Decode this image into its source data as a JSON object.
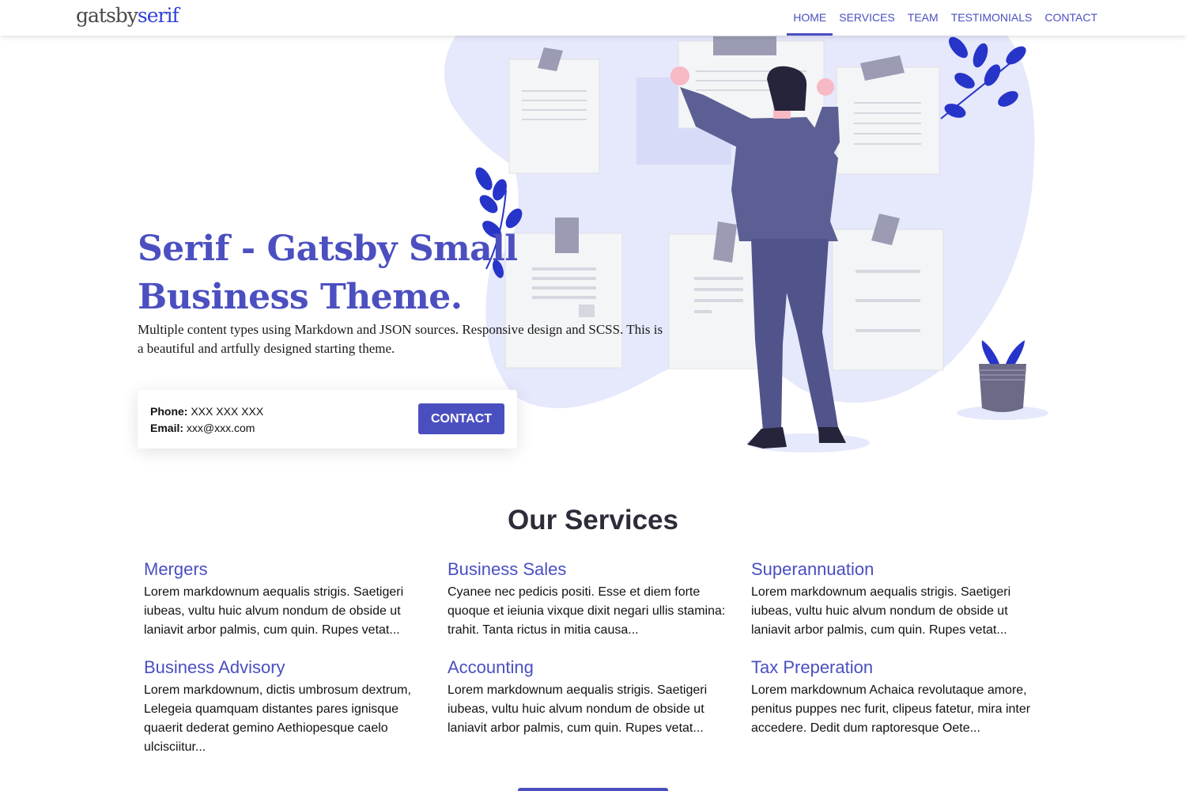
{
  "header": {
    "logo_part1": "gatsby",
    "logo_part2": "serif",
    "nav": [
      "HOME",
      "SERVICES",
      "TEAM",
      "TESTIMONIALS",
      "CONTACT"
    ],
    "active_nav": "HOME"
  },
  "hero": {
    "title": "Serif - Gatsby Small Business Theme.",
    "description": "Multiple content types using Markdown and JSON sources. Responsive design and SCSS. This is a beautiful and artfully designed starting theme."
  },
  "contact_card": {
    "phone_label": "Phone:",
    "phone_value": "XXX XXX XXX",
    "email_label": "Email:",
    "email_value": "xxx@xxx.com",
    "button_label": "CONTACT"
  },
  "services": {
    "title": "Our Services",
    "items": [
      {
        "title": "Mergers",
        "text": "Lorem markdownum aequalis strigis. Saetigeri iubeas, vultu huic alvum nondum de obside ut laniavit arbor palmis, cum quin. Rupes vetat..."
      },
      {
        "title": "Business Sales",
        "text": "Cyanee nec pedicis positi. Esse et diem forte quoque et ieiunia vixque dixit negari ullis stamina: trahit. Tanta rictus in mitia causa..."
      },
      {
        "title": "Superannuation",
        "text": "Lorem markdownum aequalis strigis. Saetigeri iubeas, vultu huic alvum nondum de obside ut laniavit arbor palmis, cum quin. Rupes vetat..."
      },
      {
        "title": "Business Advisory",
        "text": "Lorem markdownum, dictis umbrosum dextrum, Lelegeia quamquam distantes pares ignisque quaerit dederat gemino Aethiopesque caelo ulcisciitur..."
      },
      {
        "title": "Accounting",
        "text": "Lorem markdownum aequalis strigis. Saetigeri iubeas, vultu huic alvum nondum de obside ut laniavit arbor palmis, cum quin. Rupes vetat..."
      },
      {
        "title": "Tax Preperation",
        "text": "Lorem markdownum Achaica revolutaque amore, penitus puppes nec furit, clipeus fatetur, mira inter accedere. Dedit dum raptoresque Oete..."
      }
    ]
  },
  "colors": {
    "accent": "#4a4fc0",
    "logo_accent": "#2f3fd6",
    "blob": "#e6e8fb"
  }
}
